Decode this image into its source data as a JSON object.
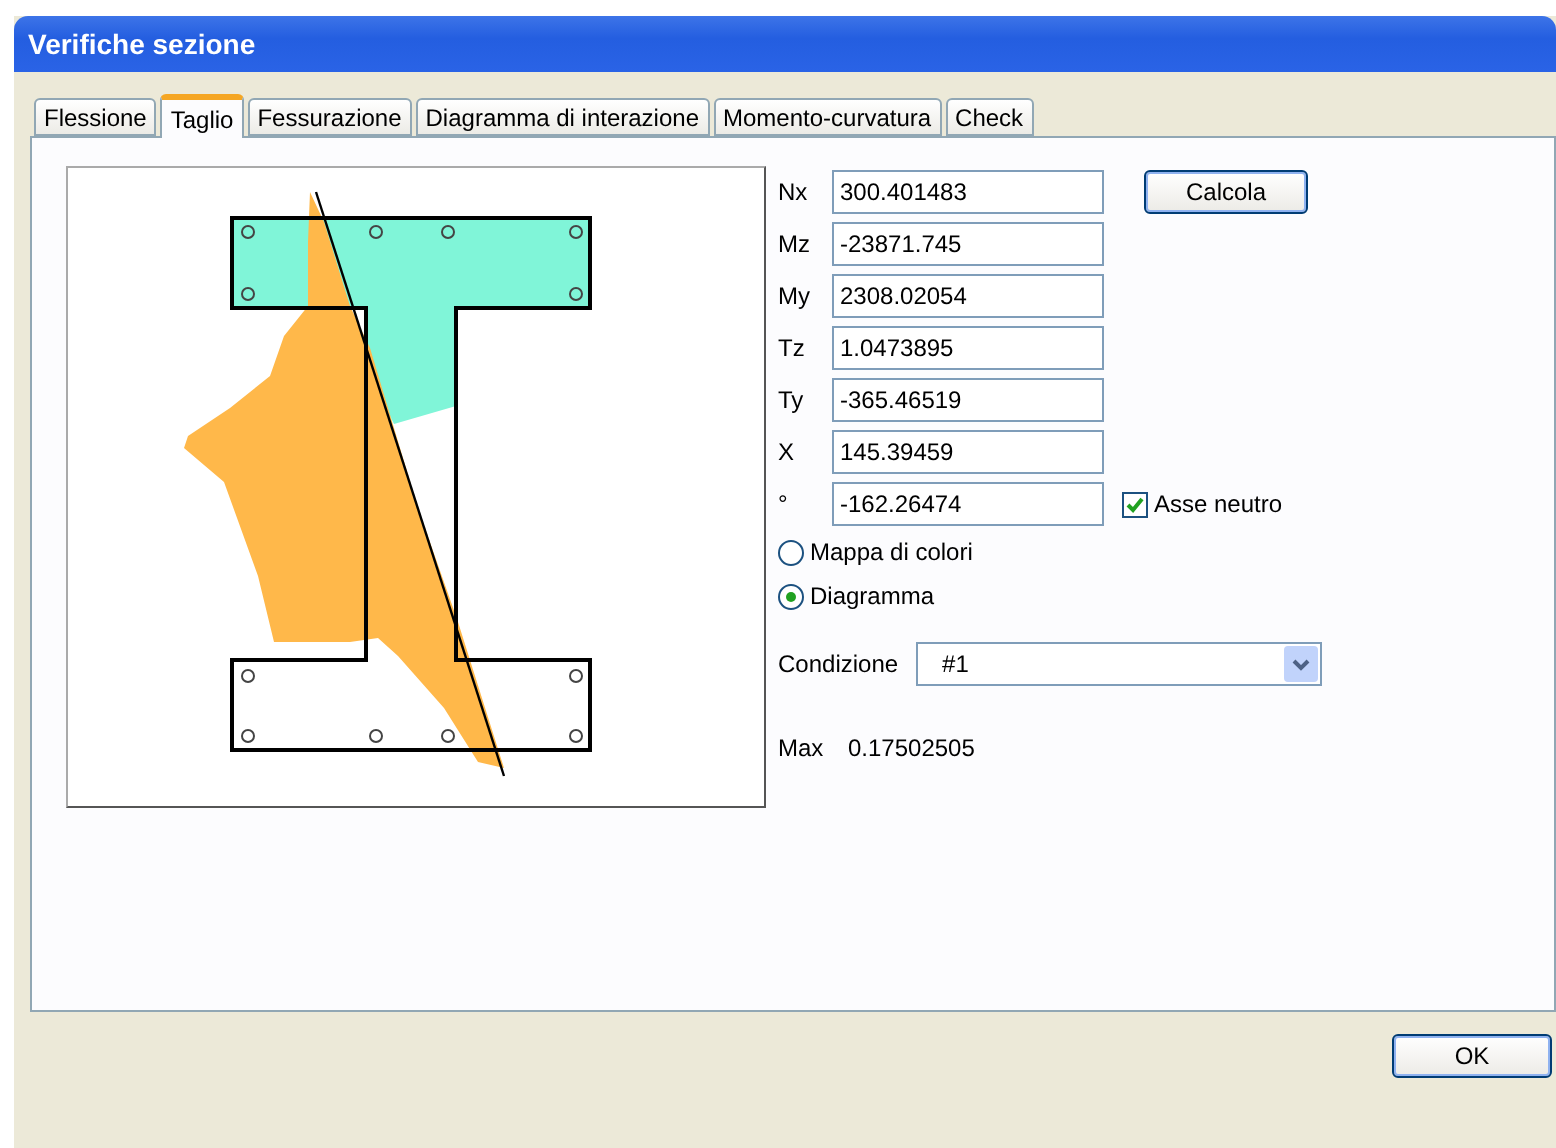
{
  "window": {
    "title": "Verifiche sezione"
  },
  "tabs": [
    {
      "label": "Flessione",
      "selected": false
    },
    {
      "label": "Taglio",
      "selected": true
    },
    {
      "label": "Fessurazione",
      "selected": false
    },
    {
      "label": "Diagramma di interazione",
      "selected": false
    },
    {
      "label": "Momento-curvatura",
      "selected": false
    },
    {
      "label": "Check",
      "selected": false
    }
  ],
  "fields": [
    {
      "label": "Nx",
      "value": "300.401483"
    },
    {
      "label": "Mz",
      "value": "-23871.745"
    },
    {
      "label": "My",
      "value": "2308.02054"
    },
    {
      "label": "Tz",
      "value": "1.0473895"
    },
    {
      "label": "Ty",
      "value": "-365.46519"
    },
    {
      "label": "X",
      "value": "145.39459"
    },
    {
      "label": "°",
      "value": "-162.26474"
    }
  ],
  "calculate_button": "Calcola",
  "neutral_axis": {
    "label": "Asse neutro",
    "checked": true
  },
  "display_modes": [
    {
      "label": "Mappa di colori",
      "selected": false
    },
    {
      "label": "Diagramma",
      "selected": true
    }
  ],
  "condition": {
    "label": "Condizione",
    "value": "#1"
  },
  "max": {
    "label": "Max",
    "value": "0.17502505"
  },
  "buttons": [
    "OK"
  ]
}
